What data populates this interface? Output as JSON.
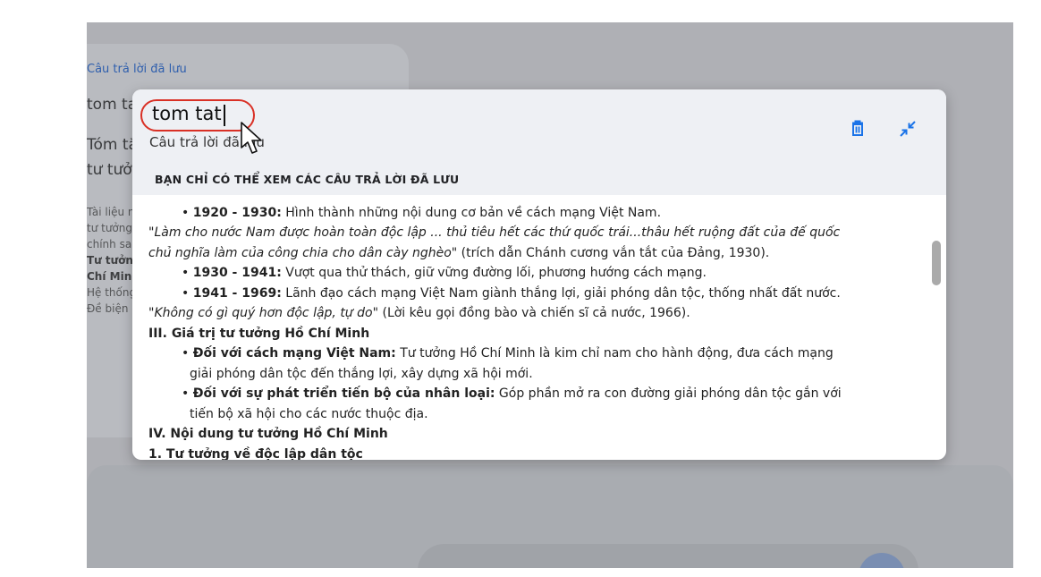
{
  "background": {
    "saved_link": "Câu trả lời đã lưu",
    "heading_1": "tom tat",
    "heading_2": "Tóm tắt T",
    "heading_3": "tư tưởng",
    "lines": [
      {
        "text": "Tài liệu này",
        "bold": false
      },
      {
        "text": "tư tưởng",
        "bold": false
      },
      {
        "text": "chính sa",
        "bold": false
      },
      {
        "text": "Tư tưởng H",
        "bold": true
      },
      {
        "text": "Chí Minh",
        "bold": true
      },
      {
        "text": "Hệ thống nhất",
        "bold": false
      },
      {
        "text": "Đề biện ch",
        "bold": false
      }
    ]
  },
  "panel": {
    "query": "tom tat",
    "subtitle": "Câu trả lời đã lưu",
    "banner": "BẠN CHỈ CÓ THỂ XEM CÁC CÂU TRẢ LỜI ĐÃ LƯU",
    "actions": {
      "delete_icon": "trash-icon",
      "collapse_icon": "collapse-arrows-icon",
      "color": "#1a73e8"
    },
    "content": [
      {
        "bullet": "•",
        "bold": "1920 - 1930:",
        "text": " Hình thành những nội dung cơ bản về cách mạng Việt Nam."
      },
      {
        "italic": "\"Làm cho nước Nam được hoàn toàn độc lập ... thủ tiêu hết các thứ quốc trái...thâu hết ruộng đất của đế quốc"
      },
      {
        "italic": "chủ nghĩa làm của công chia cho dân cày nghèo\"",
        "text": " (trích dẫn Chánh cương vắn tắt của Đảng, 1930)."
      },
      {
        "bullet": "•",
        "bold": "1930 - 1941:",
        "text": " Vượt qua thử thách, giữ vững đường lối, phương hướng cách mạng."
      },
      {
        "bullet": "•",
        "bold": "1941 - 1969:",
        "text": " Lãnh đạo cách mạng Việt Nam giành thắng lợi, giải phóng dân tộc, thống nhất đất nước."
      },
      {
        "italic": "\"Không có gì quý hơn độc lập, tự do\"",
        "text": " (Lời kêu gọi đồng bào và chiến sĩ cả nước, 1966)."
      },
      {
        "bold": "III. Giá trị tư tưởng Hồ Chí Minh"
      },
      {
        "bullet": "•",
        "bold": "Đối với cách mạng Việt Nam:",
        "text": " Tư tưởng Hồ Chí Minh là kim chỉ nam cho hành động, đưa cách mạng"
      },
      {
        "text": "giải phóng dân tộc đến thắng lợi, xây dựng xã hội mới."
      },
      {
        "bullet": "•",
        "bold": "Đối với sự phát triển tiến bộ của nhân loại:",
        "text": " Góp phần mở ra con đường giải phóng dân tộc gắn với"
      },
      {
        "text": "tiến bộ xã hội cho các nước thuộc địa."
      },
      {
        "bold": "IV. Nội dung tư tưởng Hồ Chí Minh"
      },
      {
        "bold": "1. Tư tưởng về độc lập dân tộc"
      }
    ]
  }
}
